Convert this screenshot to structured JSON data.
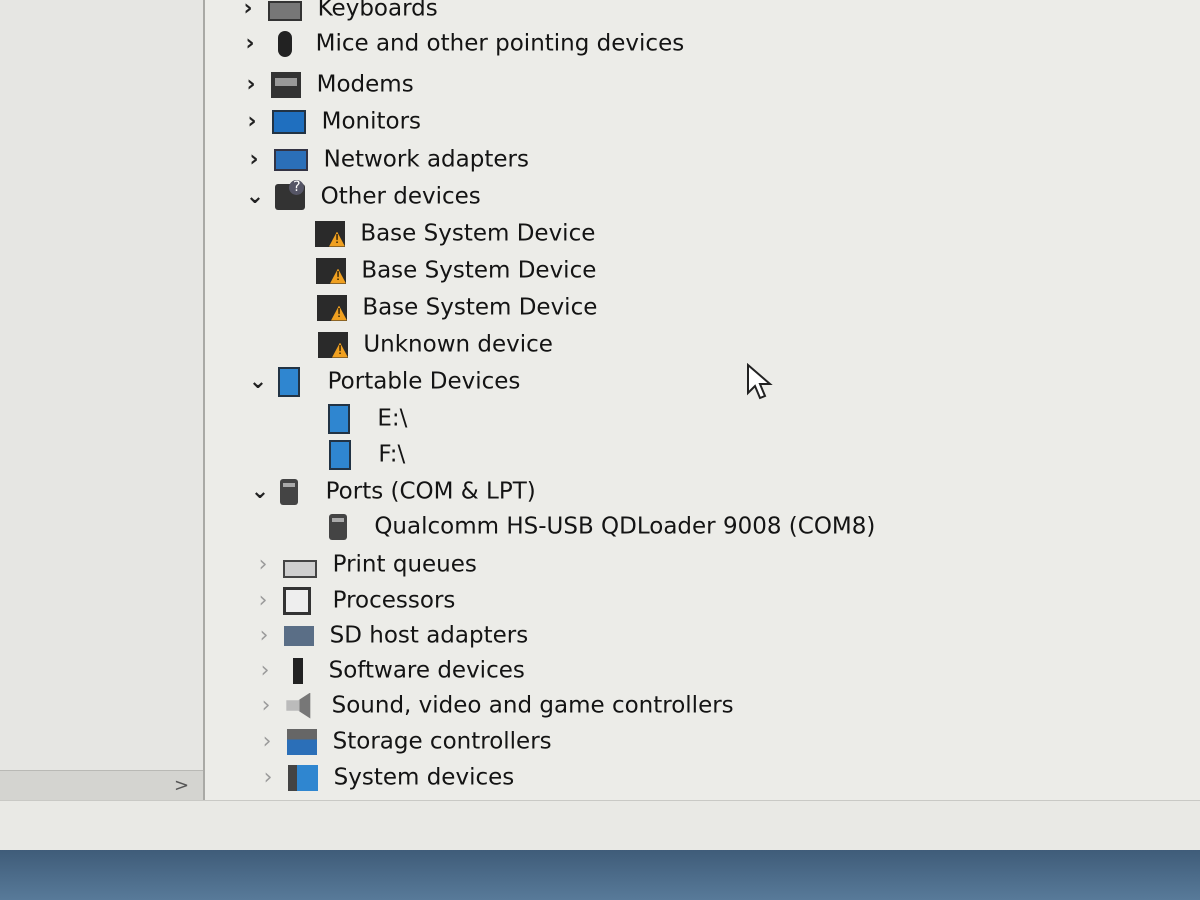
{
  "tree": {
    "items": [
      {
        "id": "keyboards",
        "label": "Keyboards",
        "icon": "keyboard-icon",
        "expanded": false
      },
      {
        "id": "mice",
        "label": "Mice and other pointing devices",
        "icon": "mouse-icon",
        "expanded": false
      },
      {
        "id": "modems",
        "label": "Modems",
        "icon": "modem-icon",
        "expanded": false
      },
      {
        "id": "monitors",
        "label": "Monitors",
        "icon": "monitor-icon",
        "expanded": false
      },
      {
        "id": "network",
        "label": "Network adapters",
        "icon": "network-adapter-icon",
        "expanded": false
      },
      {
        "id": "other",
        "label": "Other devices",
        "icon": "other-devices-icon",
        "expanded": true,
        "children": [
          {
            "label": "Base System Device",
            "icon": "warning-device-icon"
          },
          {
            "label": "Base System Device",
            "icon": "warning-device-icon"
          },
          {
            "label": "Base System Device",
            "icon": "warning-device-icon"
          },
          {
            "label": "Unknown device",
            "icon": "warning-device-icon"
          }
        ]
      },
      {
        "id": "portable",
        "label": "Portable Devices",
        "icon": "portable-device-icon",
        "expanded": true,
        "children": [
          {
            "label": "E:\\",
            "icon": "portable-device-icon"
          },
          {
            "label": "F:\\",
            "icon": "portable-device-icon"
          }
        ]
      },
      {
        "id": "ports",
        "label": "Ports (COM & LPT)",
        "icon": "port-icon",
        "expanded": true,
        "children": [
          {
            "label": "Qualcomm HS-USB QDLoader 9008 (COM8)",
            "icon": "port-icon"
          }
        ]
      },
      {
        "id": "print",
        "label": "Print queues",
        "icon": "printer-icon",
        "expanded": false
      },
      {
        "id": "processors",
        "label": "Processors",
        "icon": "processor-icon",
        "expanded": false
      },
      {
        "id": "sd",
        "label": "SD host adapters",
        "icon": "sd-host-icon",
        "expanded": false
      },
      {
        "id": "software",
        "label": "Software devices",
        "icon": "software-device-icon",
        "expanded": false
      },
      {
        "id": "sound",
        "label": "Sound, video and game controllers",
        "icon": "speaker-icon",
        "expanded": false
      },
      {
        "id": "storage",
        "label": "Storage controllers",
        "icon": "storage-controller-icon",
        "expanded": false
      },
      {
        "id": "system",
        "label": "System devices",
        "icon": "system-device-icon",
        "expanded": false
      }
    ]
  },
  "left_pane": {
    "scroll_arrow": ">"
  }
}
